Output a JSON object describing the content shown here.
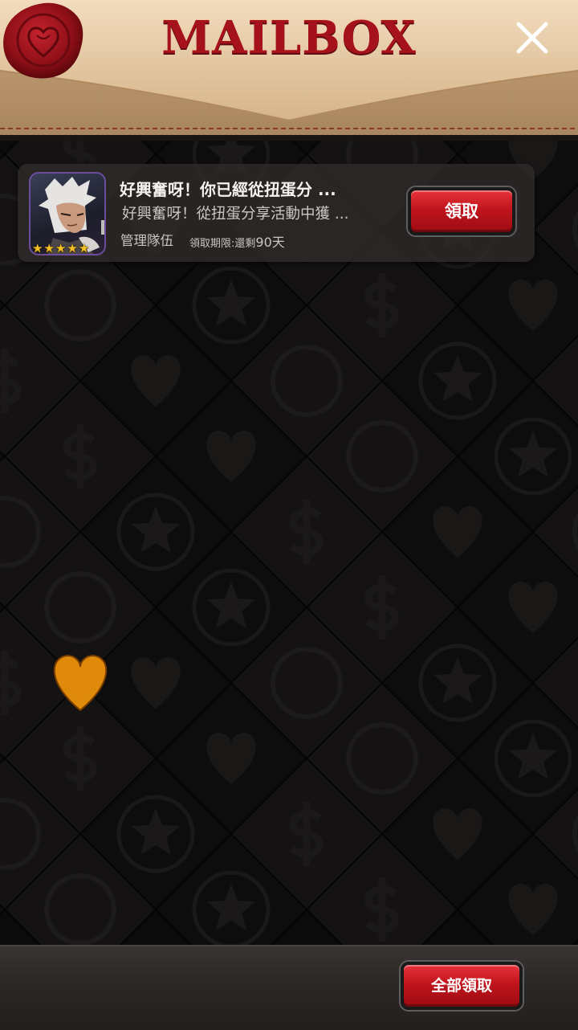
{
  "header": {
    "title": "MAILBOX",
    "close_icon": "close-icon"
  },
  "mail": {
    "title": "好興奮呀！你已經從扭蛋分 ...",
    "body": "好興奮呀！從扭蛋分享活動中獲 ...",
    "sender": "管理隊伍",
    "expire_label": "領取期限:還剩",
    "expire_value": "90天",
    "avatar_stars": 5,
    "claim_label": "領取"
  },
  "footer": {
    "claim_all_label": "全部領取"
  },
  "colors": {
    "title_red": "#a5121c",
    "button_red": "#c0151d",
    "star_gold": "#f5c024",
    "parchment": "#e0c39f"
  }
}
